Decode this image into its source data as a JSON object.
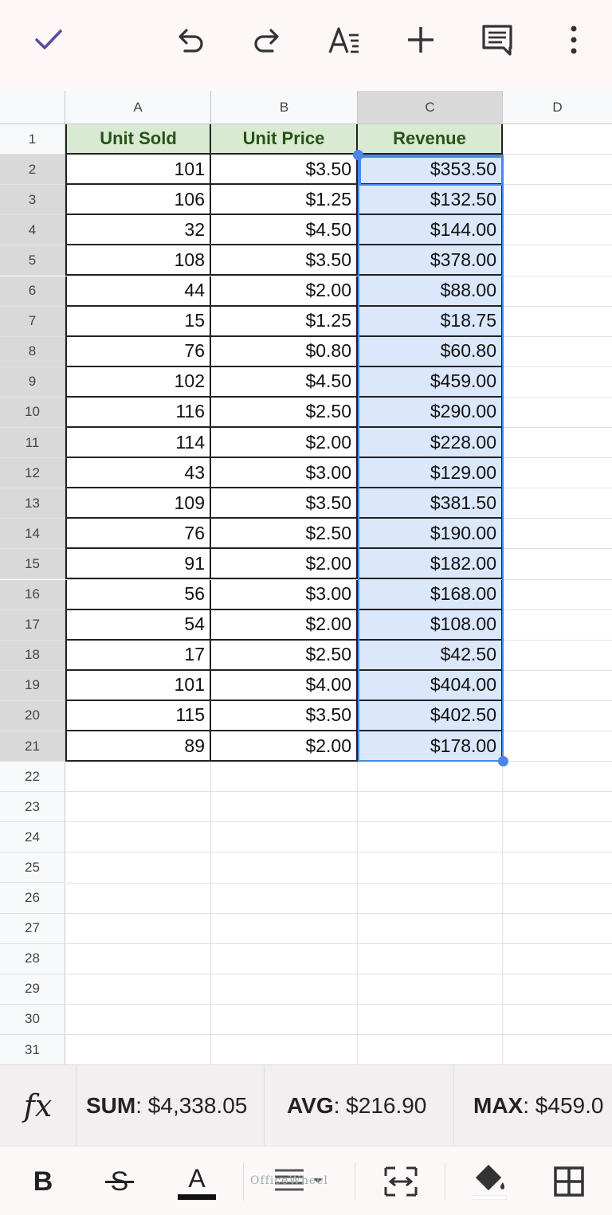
{
  "toolbar": {
    "icons": [
      "check-icon",
      "undo-icon",
      "redo-icon",
      "text-format-icon",
      "insert-icon",
      "comment-icon",
      "more-vert-icon"
    ],
    "accent": "#5b4aa0"
  },
  "columns": [
    "A",
    "B",
    "C",
    "D"
  ],
  "row_numbers": [
    "1",
    "2",
    "3",
    "4",
    "5",
    "6",
    "7",
    "8",
    "9",
    "10",
    "11",
    "12",
    "13",
    "14",
    "15",
    "16",
    "17",
    "18",
    "19",
    "20",
    "21",
    "22",
    "23",
    "24",
    "25",
    "26",
    "27",
    "28",
    "29",
    "30",
    "31"
  ],
  "table": {
    "headers": [
      "Unit Sold",
      "Unit Price",
      "Revenue"
    ],
    "rows": [
      [
        "101",
        "$3.50",
        "$353.50"
      ],
      [
        "106",
        "$1.25",
        "$132.50"
      ],
      [
        "32",
        "$4.50",
        "$144.00"
      ],
      [
        "108",
        "$3.50",
        "$378.00"
      ],
      [
        "44",
        "$2.00",
        "$88.00"
      ],
      [
        "15",
        "$1.25",
        "$18.75"
      ],
      [
        "76",
        "$0.80",
        "$60.80"
      ],
      [
        "102",
        "$4.50",
        "$459.00"
      ],
      [
        "116",
        "$2.50",
        "$290.00"
      ],
      [
        "114",
        "$2.00",
        "$228.00"
      ],
      [
        "43",
        "$3.00",
        "$129.00"
      ],
      [
        "109",
        "$3.50",
        "$381.50"
      ],
      [
        "76",
        "$2.50",
        "$190.00"
      ],
      [
        "91",
        "$2.00",
        "$182.00"
      ],
      [
        "56",
        "$3.00",
        "$168.00"
      ],
      [
        "54",
        "$2.00",
        "$108.00"
      ],
      [
        "17",
        "$2.50",
        "$42.50"
      ],
      [
        "101",
        "$4.00",
        "$404.00"
      ],
      [
        "115",
        "$3.50",
        "$402.50"
      ],
      [
        "89",
        "$2.00",
        "$178.00"
      ]
    ],
    "header_fill": "#d9ead3",
    "header_text_color": "#275317",
    "selection_fill": "#dbe7fb",
    "selection_border": "#4a86e8"
  },
  "stats": {
    "fx_label": "fx",
    "sum_label": "SUM",
    "sum_value": ": $4,338.05",
    "avg_label": "AVG",
    "avg_value": ": $216.90",
    "max_label": "MAX",
    "max_value": ": $459.0"
  },
  "format_bar": {
    "bold_label": "B",
    "strike_label": "S",
    "text_color_label": "A",
    "icons": [
      "bold-icon",
      "strikethrough-icon",
      "text-color-icon",
      "align-icon",
      "merge-cells-icon",
      "fill-color-icon",
      "borders-icon"
    ]
  },
  "watermark": "OfficeWheel"
}
